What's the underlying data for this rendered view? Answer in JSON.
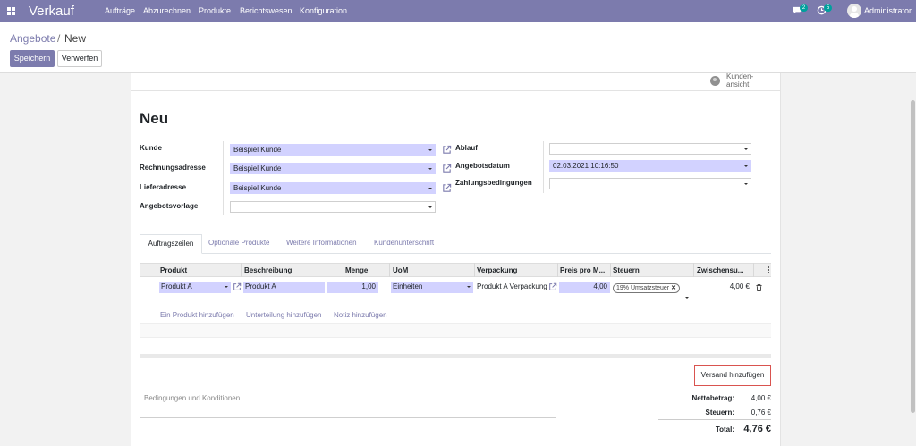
{
  "navbar": {
    "app_name": "Verkauf",
    "menu": [
      "Aufträge",
      "Abzurechnen",
      "Produkte",
      "Berichtswesen",
      "Konfiguration"
    ],
    "messages_count": "2",
    "activities_count": "5",
    "user": "Administrator",
    "color": "#7c7bad"
  },
  "breadcrumb": {
    "parent": "Angebote",
    "separator": "/",
    "current": "New"
  },
  "buttons": {
    "save": "Speichern",
    "discard": "Verwerfen"
  },
  "smart_button": {
    "label": "Kunden-ansicht",
    "icon": "globe-icon"
  },
  "form": {
    "title": "Neu",
    "left_fields": [
      {
        "label": "Kunde",
        "value": "Beispiel Kunde"
      },
      {
        "label": "Rechnungsadresse",
        "value": "Beispiel Kunde"
      },
      {
        "label": "Lieferadresse",
        "value": "Beispiel Kunde"
      },
      {
        "label": "Angebotsvorlage",
        "value": ""
      }
    ],
    "right_fields": [
      {
        "label": "Ablauf",
        "value": ""
      },
      {
        "label": "Angebotsdatum",
        "value": "02.03.2021 10:16:50"
      },
      {
        "label": "Zahlungsbedingungen",
        "value": ""
      }
    ]
  },
  "tabs": [
    "Auftragszeilen",
    "Optionale Produkte",
    "Weitere Informationen",
    "Kundenunterschrift"
  ],
  "table": {
    "headers": [
      "Produkt",
      "Beschreibung",
      "Menge",
      "UoM",
      "Verpackung",
      "Preis pro M...",
      "Steuern",
      "Zwischensu..."
    ],
    "rows": [
      {
        "product": "Produkt A",
        "description": "Produkt A",
        "quantity": "1,00",
        "uom": "Einheiten",
        "packaging": "Produkt A Verpackung",
        "price": "4,00",
        "tax": "19% Umsatzsteuer",
        "subtotal": "4,00 €"
      }
    ],
    "add_links": [
      "Ein Produkt hinzufügen",
      "Unterteilung hinzufügen",
      "Notiz hinzufügen"
    ]
  },
  "shipping_button": "Versand hinzufügen",
  "notes_placeholder": "Bedingungen und Konditionen",
  "totals": {
    "net_label": "Nettobetrag:",
    "net_value": "4,00 €",
    "tax_label": "Steuern:",
    "tax_value": "0,76 €",
    "total_label": "Total:",
    "total_value": "4,76 €"
  }
}
